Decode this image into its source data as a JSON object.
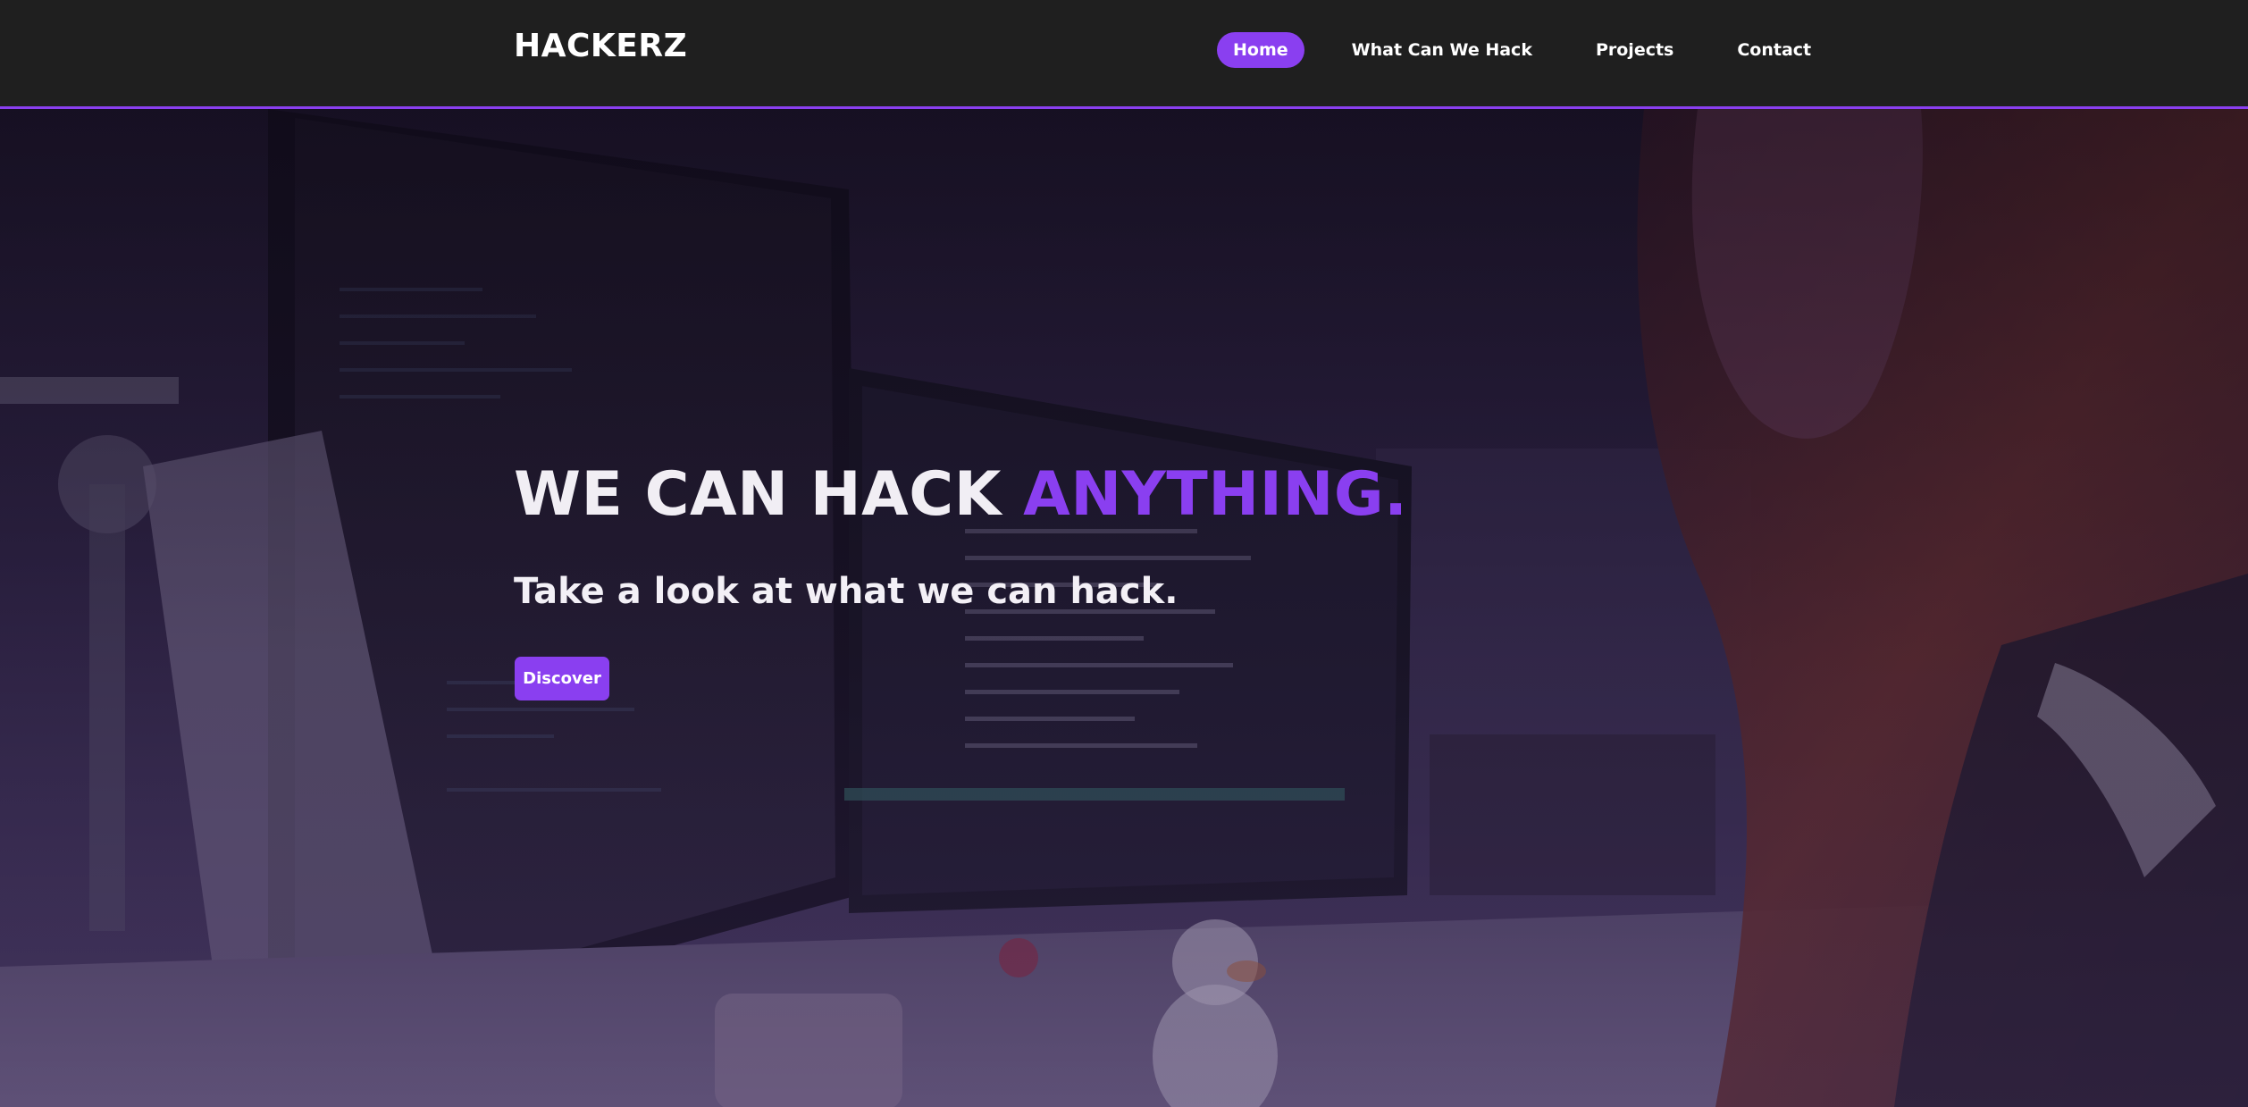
{
  "brand": "HACKERZ",
  "nav": {
    "items": [
      {
        "label": "Home",
        "active": true
      },
      {
        "label": "What Can We Hack",
        "active": false
      },
      {
        "label": "Projects",
        "active": false
      },
      {
        "label": "Contact",
        "active": false
      }
    ]
  },
  "hero": {
    "headline_main": "WE CAN HACK",
    "headline_accent": "ANYTHING.",
    "subheadline": "Take a look at what we can hack.",
    "cta_label": "Discover"
  },
  "colors": {
    "accent": "#8a3ff0",
    "navbar_bg": "#1f1f1f",
    "text": "#ffffff"
  }
}
